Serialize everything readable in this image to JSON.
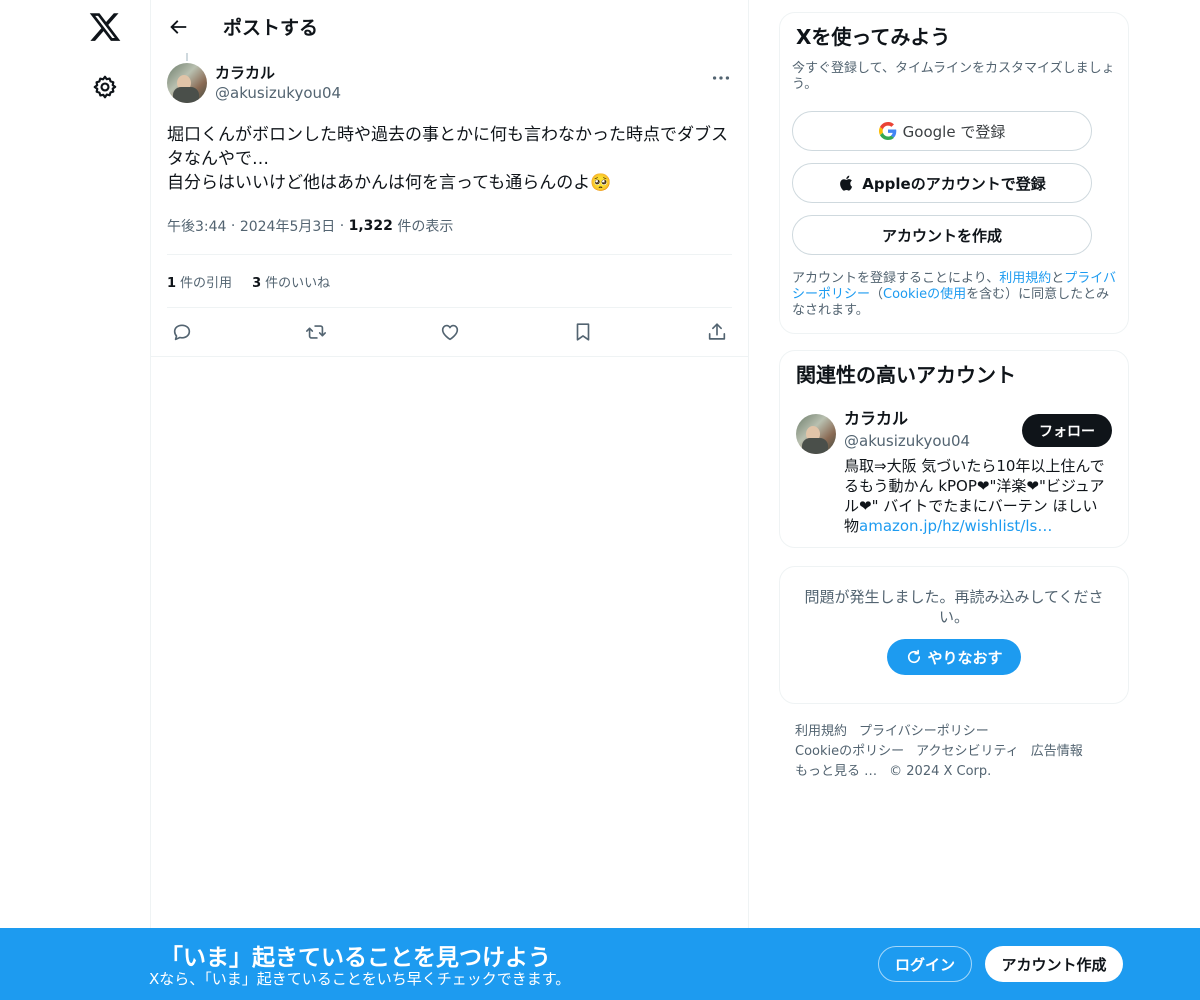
{
  "header": {
    "title": "ポストする"
  },
  "post": {
    "display_name": "カラカル",
    "handle": "@akusizukyou04",
    "text": "堀口くんがボロンした時や過去の事とかに何も言わなかった時点でダブスタなんやで…\n自分らはいいけど他はあかんは何を言っても通らんのよ🥺",
    "time": "午後3:44",
    "date": "2024年5月3日",
    "views_count": "1,322",
    "views_label": "件の表示",
    "quotes_count": "1",
    "quotes_label": "件の引用",
    "likes_count": "3",
    "likes_label": "件のいいね"
  },
  "signup_card": {
    "title": "Xを使ってみよう",
    "subtitle": "今すぐ登録して、タイムラインをカスタマイズしましょう。",
    "google_label": "Google で登録",
    "apple_label": "Appleのアカウントで登録",
    "create_label": "アカウントを作成",
    "terms_prefix": "アカウントを登録することにより、",
    "terms_link1": "利用規約",
    "terms_mid1": "と",
    "terms_link2": "プライバシーポリシー",
    "terms_mid2": "（",
    "terms_link3": "Cookieの使用",
    "terms_suffix": "を含む）に同意したとみなされます。"
  },
  "related": {
    "title": "関連性の高いアカウント",
    "display_name": "カラカル",
    "handle": "@akusizukyou04",
    "follow_label": "フォロー",
    "bio_text": "鳥取⇒大阪 気づいたら10年以上住んでるもう動かん kPOP❤\"洋楽❤\"ビジュアル❤\" バイトでたまにバーテン ほしい物",
    "bio_link": "amazon.jp/hz/wishlist/ls…"
  },
  "error_card": {
    "message": "問題が発生しました。再読み込みしてください。",
    "retry_label": "やりなおす"
  },
  "footer": {
    "terms": "利用規約",
    "privacy": "プライバシーポリシー",
    "cookie": "Cookieのポリシー",
    "accessibility": "アクセシビリティ",
    "ads": "広告情報",
    "more": "もっと見る …",
    "copyright": "© 2024 X Corp."
  },
  "banner": {
    "title": "「いま」起きていることを見つけよう",
    "subtitle": "Xなら、「いま」起きていることをいち早くチェックできます。",
    "login_label": "ログイン",
    "signup_label": "アカウント作成"
  },
  "colors": {
    "accent": "#1d9bf0",
    "text": "#0f1419",
    "secondary": "#536471"
  },
  "icons": [
    "x-logo-icon",
    "gear-icon",
    "back-arrow-icon",
    "more-icon",
    "reply-icon",
    "repost-icon",
    "like-icon",
    "bookmark-icon",
    "share-icon",
    "google-icon",
    "apple-icon",
    "refresh-icon"
  ]
}
